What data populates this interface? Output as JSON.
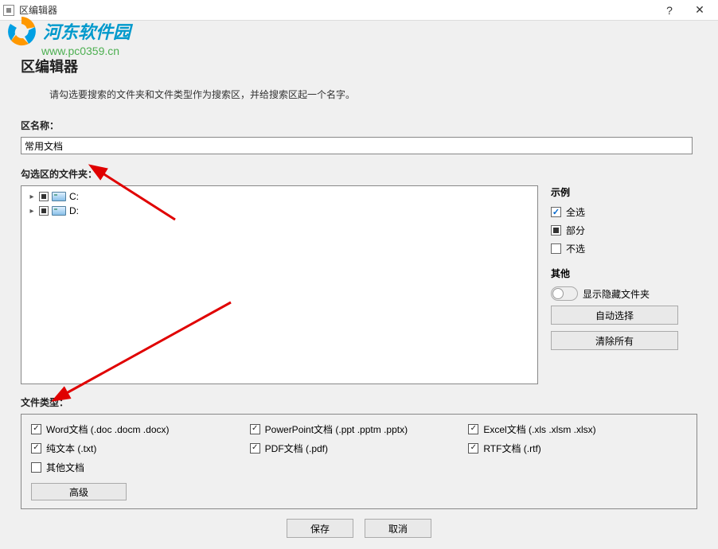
{
  "titlebar": {
    "title": "区编辑器"
  },
  "watermark": {
    "brand": "河东软件园",
    "url": "www.pc0359.cn"
  },
  "heading": "区编辑器",
  "subhelp": "请勾选要搜索的文件夹和文件类型作为搜索区，并给搜索区起一个名字。",
  "fields": {
    "name_label": "区名称：",
    "name_value": "常用文档",
    "folders_label": "勾选区的文件夹：",
    "filetypes_label": "文件类型："
  },
  "tree": {
    "items": [
      {
        "label": "C:"
      },
      {
        "label": "D:"
      }
    ]
  },
  "side": {
    "legend_title": "示例",
    "legend_full": "全选",
    "legend_partial": "部分",
    "legend_none": "不选",
    "other_title": "其他",
    "show_hidden": "显示隐藏文件夹",
    "auto_select": "自动选择",
    "clear_all": "清除所有"
  },
  "filetypes": {
    "word": "Word文档 (.doc .docm .docx)",
    "txt": "纯文本 (.txt)",
    "other": "其他文档",
    "ppt": "PowerPoint文档 (.ppt .pptm .pptx)",
    "pdf": "PDF文档 (.pdf)",
    "excel": "Excel文档 (.xls .xlsm .xlsx)",
    "rtf": "RTF文档 (.rtf)",
    "advanced": "高级"
  },
  "footer": {
    "save": "保存",
    "cancel": "取消"
  }
}
